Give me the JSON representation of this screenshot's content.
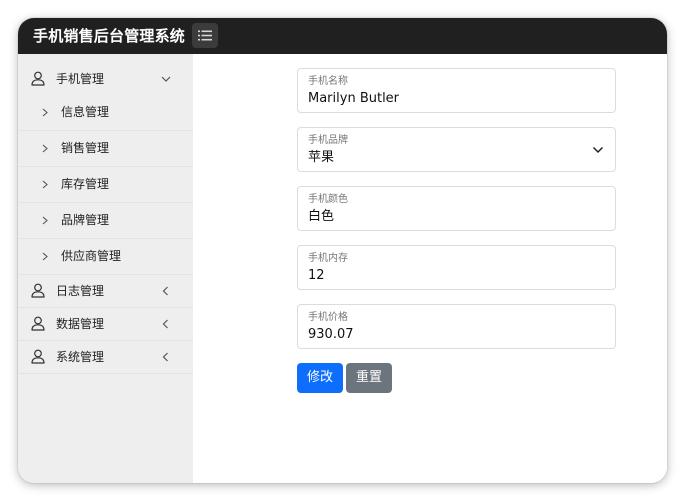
{
  "app": {
    "title": "手机销售后台管理系统"
  },
  "sidebar": {
    "groups": [
      {
        "label": "手机管理",
        "expanded": true,
        "items": [
          {
            "label": "信息管理"
          },
          {
            "label": "销售管理"
          },
          {
            "label": "库存管理"
          },
          {
            "label": "品牌管理"
          },
          {
            "label": "供应商管理"
          }
        ]
      },
      {
        "label": "日志管理",
        "expanded": false
      },
      {
        "label": "数据管理",
        "expanded": false
      },
      {
        "label": "系统管理",
        "expanded": false
      }
    ]
  },
  "form": {
    "fields": [
      {
        "label": "手机名称",
        "value": "Marilyn Butler"
      },
      {
        "label": "手机品牌",
        "value": "苹果",
        "type": "select"
      },
      {
        "label": "手机颜色",
        "value": "白色"
      },
      {
        "label": "手机内存",
        "value": "12"
      },
      {
        "label": "手机价格",
        "value": "930.07"
      }
    ],
    "buttons": {
      "submit": "修改",
      "reset": "重置"
    }
  },
  "icons": {
    "toggle": "list-icon",
    "group": "user-icon",
    "expanded": "chevron-down-icon",
    "collapsed": "chevron-left-icon",
    "sub": "chevron-right-icon"
  },
  "colors": {
    "topbar": "#202020",
    "sidebar": "#eeeeee",
    "primary": "#0d6efd",
    "secondary": "#6c757d"
  }
}
